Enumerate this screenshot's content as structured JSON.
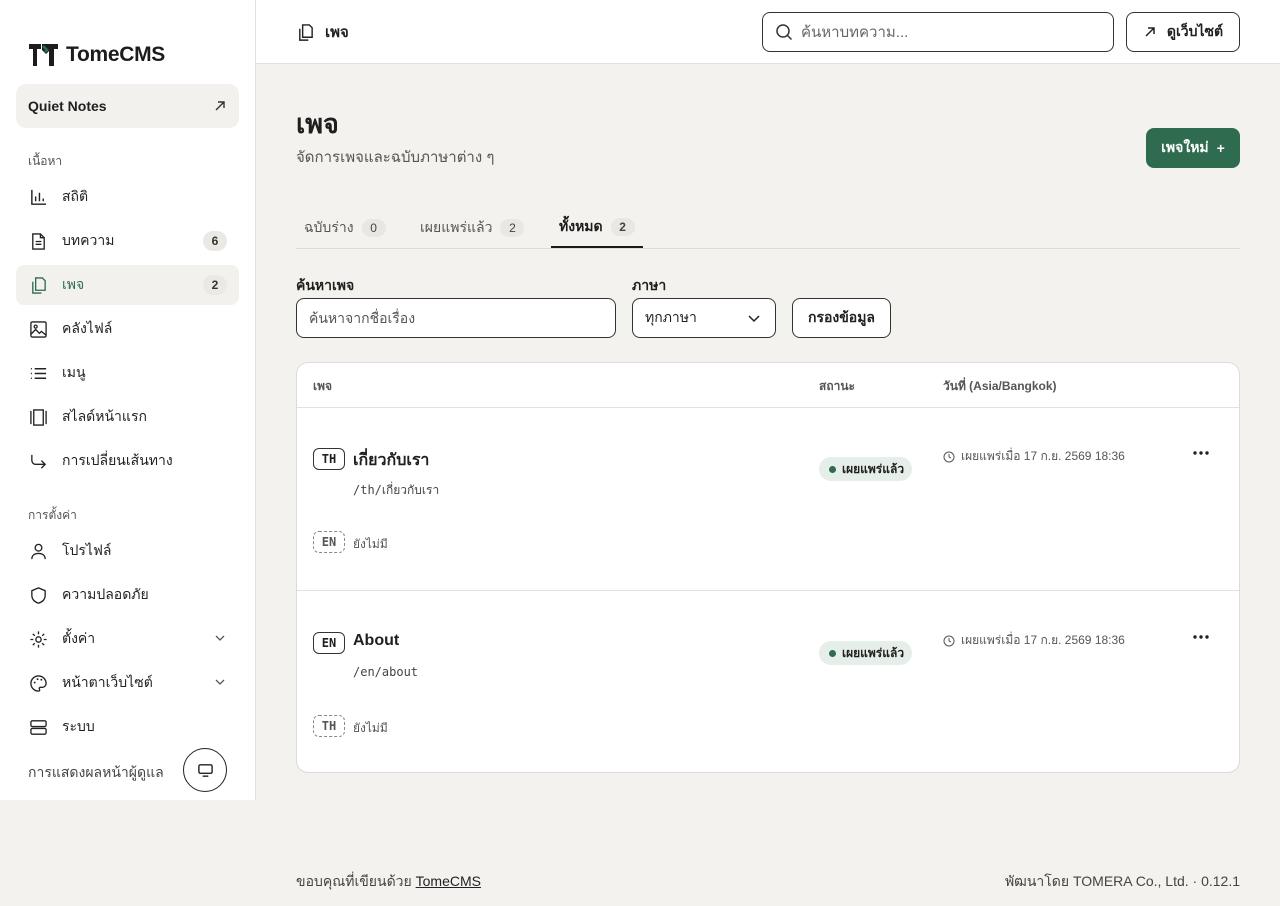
{
  "brand": {
    "name": "TomeCMS"
  },
  "site": {
    "name": "Quiet Notes"
  },
  "sidebar": {
    "content_label": "เนื้อหา",
    "settings_label": "การตั้งค่า",
    "items": [
      {
        "label": "สถิติ",
        "icon": "chart-icon"
      },
      {
        "label": "บทความ",
        "icon": "document-icon",
        "count": "6"
      },
      {
        "label": "เพจ",
        "icon": "pages-icon",
        "count": "2"
      },
      {
        "label": "คลังไฟล์",
        "icon": "image-icon"
      },
      {
        "label": "เมนู",
        "icon": "list-icon"
      },
      {
        "label": "สไลด์หน้าแรก",
        "icon": "slides-icon"
      },
      {
        "label": "การเปลี่ยนเส้นทาง",
        "icon": "redirect-icon"
      }
    ],
    "settings_items": [
      {
        "label": "โปรไฟล์",
        "icon": "user-icon"
      },
      {
        "label": "ความปลอดภัย",
        "icon": "shield-icon"
      },
      {
        "label": "ตั้งค่า",
        "icon": "gear-icon"
      },
      {
        "label": "หน้าตาเว็บไซต์",
        "icon": "palette-icon"
      },
      {
        "label": "ระบบ",
        "icon": "server-icon"
      }
    ],
    "admin_display": "การแสดงผลหน้าผู้ดูแล"
  },
  "topbar": {
    "breadcrumb": "เพจ",
    "search_placeholder": "ค้นหาบทความ...",
    "view_site": "ดูเว็บไซต์"
  },
  "page": {
    "title": "เพจ",
    "subtitle": "จัดการเพจและฉบับภาษาต่าง ๆ",
    "new_button": "เพจใหม่"
  },
  "tabs": [
    {
      "label": "ฉบับร่าง",
      "count": "0"
    },
    {
      "label": "เผยแพร่แล้ว",
      "count": "2"
    },
    {
      "label": "ทั้งหมด",
      "count": "2"
    }
  ],
  "filters": {
    "search_label": "ค้นหาเพจ",
    "search_placeholder": "ค้นหาจากชื่อเรื่อง",
    "lang_label": "ภาษา",
    "lang_value": "ทุกภาษา",
    "filter_button": "กรองข้อมูล"
  },
  "table": {
    "headers": {
      "page": "เพจ",
      "status": "สถานะ",
      "date": "วันที่ (Asia/Bangkok)"
    },
    "rows": [
      {
        "lang": "TH",
        "title": "เกี่ยวกับเรา",
        "path": "/th/เกี่ยวกับเรา",
        "status": "เผยแพร่แล้ว",
        "date": "เผยแพร่เมื่อ 17 ก.ย. 2569 18:36",
        "missing_lang": "EN",
        "missing_text": "ยังไม่มี"
      },
      {
        "lang": "EN",
        "title": "About",
        "path": "/en/about",
        "status": "เผยแพร่แล้ว",
        "date": "เผยแพร่เมื่อ 17 ก.ย. 2569 18:36",
        "missing_lang": "TH",
        "missing_text": "ยังไม่มี"
      }
    ]
  },
  "footer": {
    "thanks": "ขอบคุณที่เขียนด้วย",
    "link": "TomeCMS",
    "credit": "พัฒนาโดย TOMERA Co., Ltd. · 0.12.1"
  },
  "colors": {
    "accent": "#2e6b4f",
    "background": "#f3f2ee"
  }
}
